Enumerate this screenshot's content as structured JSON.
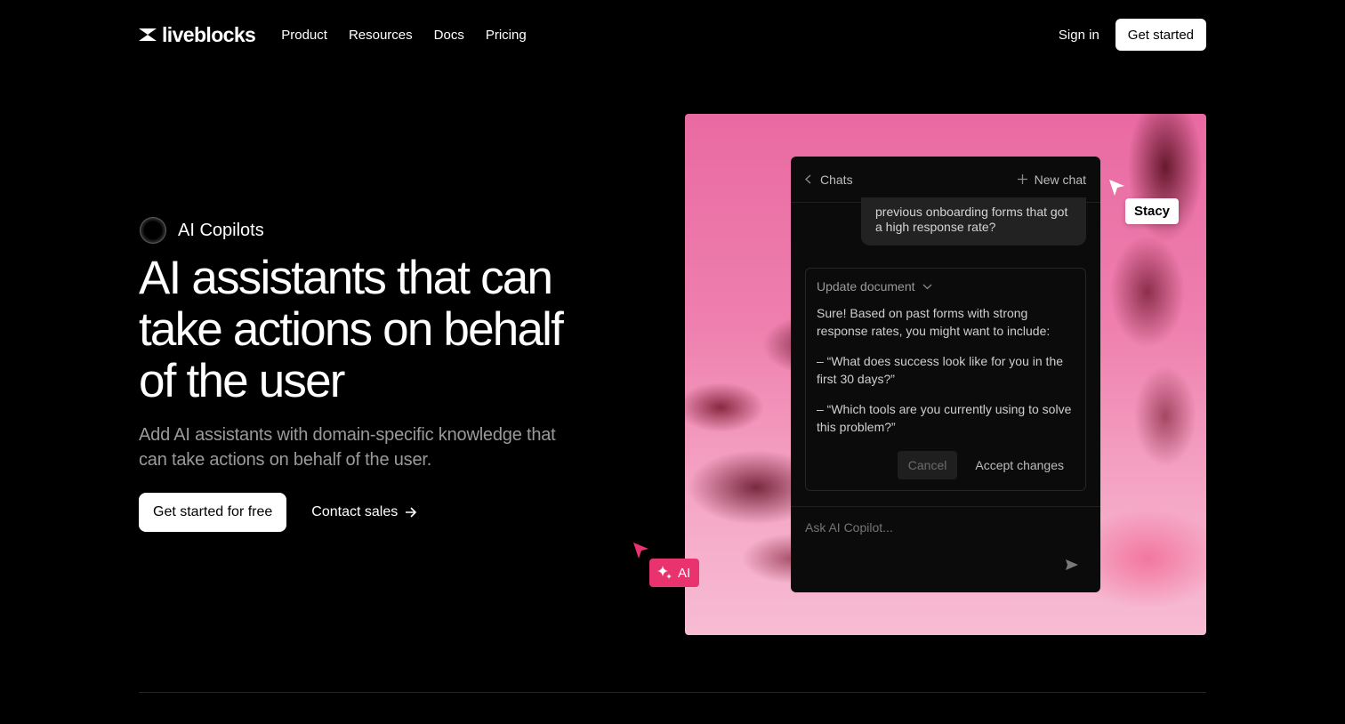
{
  "nav": {
    "logo_text": "liveblocks",
    "links": [
      "Product",
      "Resources",
      "Docs",
      "Pricing"
    ],
    "sign_in": "Sign in",
    "get_started": "Get started"
  },
  "hero": {
    "badge": "AI Copilots",
    "headline": "AI assistants that can take actions on behalf of the user",
    "subhead": "Add AI assistants with domain-specific knowledge that can take actions on behalf of the user.",
    "primary_cta": "Get started for free",
    "secondary_cta": "Contact sales"
  },
  "chat": {
    "back_label": "Chats",
    "new_chat_label": "New chat",
    "user_message": "previous onboarding forms that got a high response rate?",
    "tool_title": "Update document",
    "tool_paragraphs": [
      "Sure! Based on past forms with strong response rates, you might want to include:",
      "– “What does success look like for you in the first 30 days?”",
      "– “Which tools are you currently using to solve this problem?”"
    ],
    "cancel": "Cancel",
    "accept": "Accept changes",
    "composer_placeholder": "Ask AI Copilot..."
  },
  "cursors": {
    "user_name": "Stacy",
    "ai_label": "AI"
  },
  "colors": {
    "accent_pink": "#e8336e",
    "background": "#000000"
  },
  "icons": [
    "logo-mark-icon",
    "chevron-left-icon",
    "plus-icon",
    "chevron-down-icon",
    "send-icon",
    "pointer-cursor-icon",
    "sparkle-icon",
    "arrow-right-icon"
  ]
}
